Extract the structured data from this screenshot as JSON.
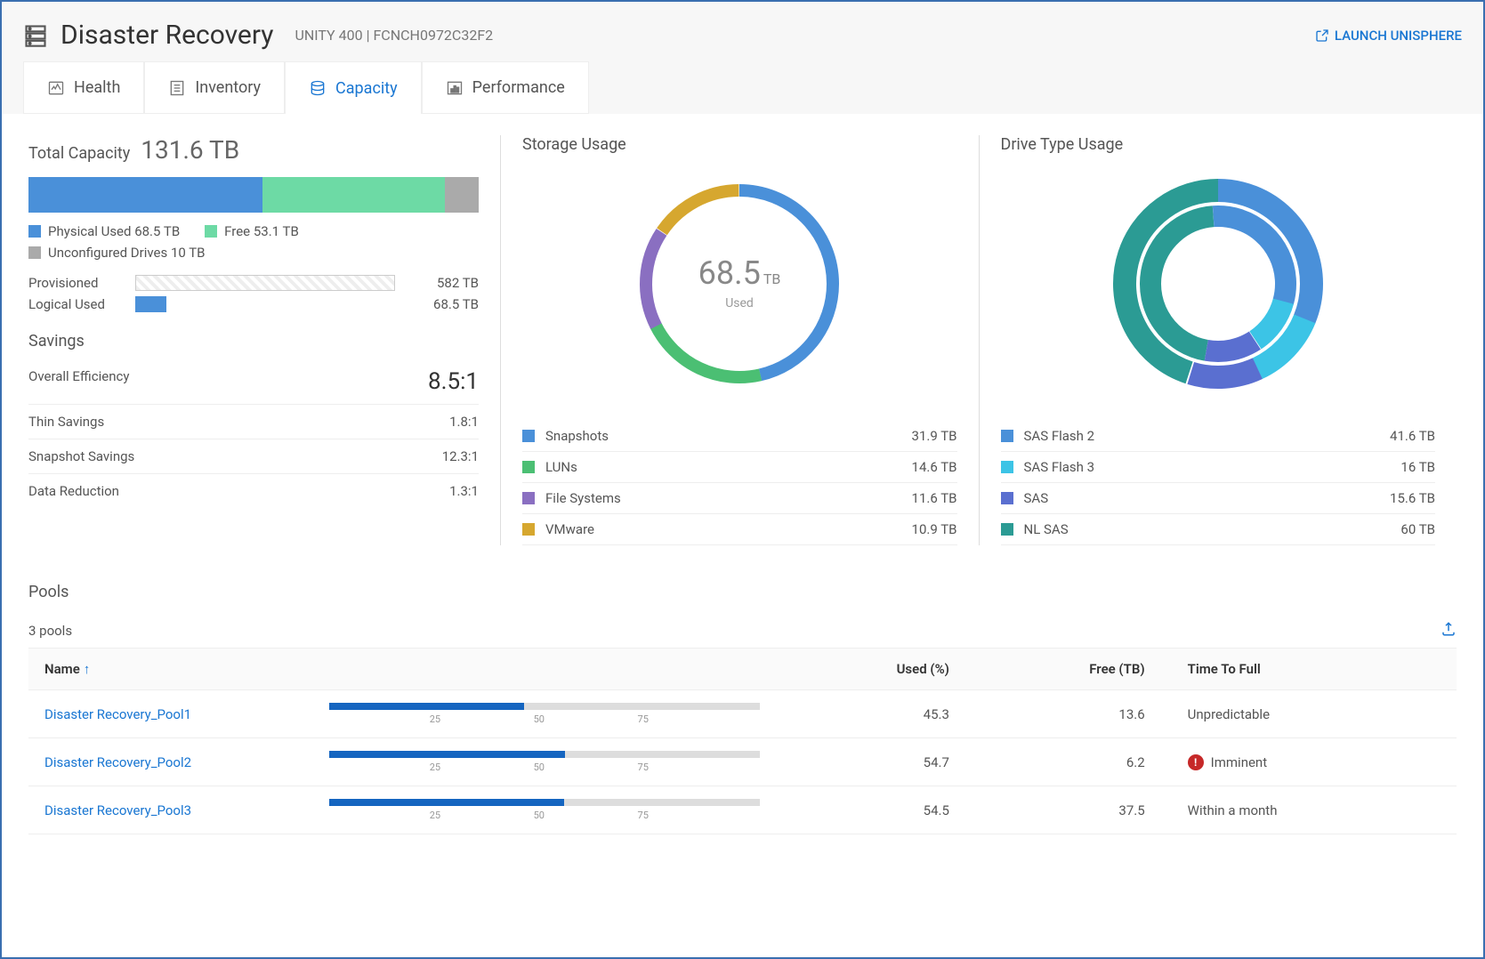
{
  "header": {
    "title": "Disaster Recovery",
    "subtitle": "UNITY 400 | FCNCH0972C32F2",
    "launch": "LAUNCH UNISPHERE"
  },
  "tabs": {
    "health": "Health",
    "inventory": "Inventory",
    "capacity": "Capacity",
    "performance": "Performance"
  },
  "capacity": {
    "label": "Total Capacity",
    "total": "131.6 TB",
    "legend": {
      "used_label": "Physical Used 68.5 TB",
      "free_label": "Free 53.1 TB",
      "unconf_label": "Unconfigured Drives 10 TB"
    },
    "provisioned_label": "Provisioned",
    "provisioned_value": "582 TB",
    "logical_label": "Logical Used",
    "logical_value": "68.5 TB",
    "savings_label": "Savings",
    "overall_label": "Overall Efficiency",
    "overall_value": "8.5:1",
    "thin_label": "Thin Savings",
    "thin_value": "1.8:1",
    "snap_label": "Snapshot Savings",
    "snap_value": "12.3:1",
    "datared_label": "Data Reduction",
    "datared_value": "1.3:1"
  },
  "storage": {
    "title": "Storage Usage",
    "center_value": "68.5",
    "center_unit": "TB",
    "center_sub": "Used",
    "items": [
      {
        "name": "Snapshots",
        "value": "31.9 TB",
        "color": "#4a90d9"
      },
      {
        "name": "LUNs",
        "value": "14.6 TB",
        "color": "#4bbf73"
      },
      {
        "name": "File Systems",
        "value": "11.6 TB",
        "color": "#8a6fc1"
      },
      {
        "name": "VMware",
        "value": "10.9 TB",
        "color": "#d6a72f"
      }
    ]
  },
  "drive": {
    "title": "Drive Type Usage",
    "items": [
      {
        "name": "SAS Flash 2",
        "value": "41.6 TB",
        "color": "#4a90d9"
      },
      {
        "name": "SAS Flash 3",
        "value": "16 TB",
        "color": "#3cc4e6"
      },
      {
        "name": "SAS",
        "value": "15.6 TB",
        "color": "#5a6fd0"
      },
      {
        "name": "NL SAS",
        "value": "60 TB",
        "color": "#2b9b94"
      }
    ]
  },
  "pools": {
    "title": "Pools",
    "count": "3 pools",
    "col_name": "Name",
    "col_used": "Used (%)",
    "col_free": "Free (TB)",
    "col_time": "Time To Full",
    "ticks": [
      "0",
      "25",
      "50",
      "75",
      "100"
    ],
    "rows": [
      {
        "name": "Disaster Recovery_Pool1",
        "used": "45.3",
        "free": "13.6",
        "time": "Unpredictable",
        "warn": false
      },
      {
        "name": "Disaster Recovery_Pool2",
        "used": "54.7",
        "free": "6.2",
        "time": "Imminent",
        "warn": true
      },
      {
        "name": "Disaster Recovery_Pool3",
        "used": "54.5",
        "free": "37.5",
        "time": "Within a month",
        "warn": false
      }
    ]
  },
  "chart_data": [
    {
      "type": "bar",
      "title": "Total Capacity",
      "categories": [
        "Physical Used",
        "Free",
        "Unconfigured Drives"
      ],
      "values": [
        68.5,
        53.1,
        10
      ],
      "unit": "TB",
      "total": 131.6
    },
    {
      "type": "pie",
      "title": "Storage Usage",
      "series": [
        {
          "name": "Snapshots",
          "value": 31.9
        },
        {
          "name": "LUNs",
          "value": 14.6
        },
        {
          "name": "File Systems",
          "value": 11.6
        },
        {
          "name": "VMware",
          "value": 10.9
        }
      ],
      "unit": "TB",
      "center_label": "Used",
      "center_value": 68.5
    },
    {
      "type": "pie",
      "title": "Drive Type Usage",
      "series": [
        {
          "name": "SAS Flash 2",
          "value": 41.6
        },
        {
          "name": "SAS Flash 3",
          "value": 16
        },
        {
          "name": "SAS",
          "value": 15.6
        },
        {
          "name": "NL SAS",
          "value": 60
        }
      ],
      "unit": "TB"
    },
    {
      "type": "table",
      "title": "Pools",
      "columns": [
        "Name",
        "Used (%)",
        "Free (TB)",
        "Time To Full"
      ],
      "rows": [
        [
          "Disaster Recovery_Pool1",
          45.3,
          13.6,
          "Unpredictable"
        ],
        [
          "Disaster Recovery_Pool2",
          54.7,
          6.2,
          "Imminent"
        ],
        [
          "Disaster Recovery_Pool3",
          54.5,
          37.5,
          "Within a month"
        ]
      ]
    }
  ]
}
